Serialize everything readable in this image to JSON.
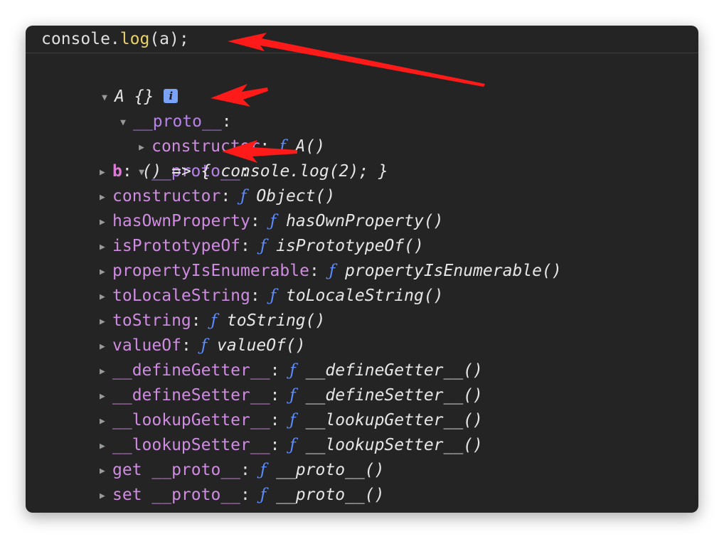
{
  "command": {
    "prefix": "console.",
    "func": "log",
    "suffix": "(a);"
  },
  "root": {
    "label": "A {}",
    "info_badge": "i"
  },
  "tree": {
    "proto1": {
      "key": "__proto__",
      "colon": ":"
    },
    "constructor_a": {
      "key": "constructor",
      "colon": ":",
      "f": "ƒ",
      "val": "A()"
    },
    "proto2": {
      "key": "__proto__",
      "colon": ":"
    },
    "items": [
      {
        "key": "b",
        "colon": ":",
        "f": "",
        "val": "() => { console.log(2); }",
        "own": true
      },
      {
        "key": "constructor",
        "colon": ":",
        "f": "ƒ",
        "val": "Object()"
      },
      {
        "key": "hasOwnProperty",
        "colon": ":",
        "f": "ƒ",
        "val": "hasOwnProperty()"
      },
      {
        "key": "isPrototypeOf",
        "colon": ":",
        "f": "ƒ",
        "val": "isPrototypeOf()"
      },
      {
        "key": "propertyIsEnumerable",
        "colon": ":",
        "f": "ƒ",
        "val": "propertyIsEnumerable()"
      },
      {
        "key": "toLocaleString",
        "colon": ":",
        "f": "ƒ",
        "val": "toLocaleString()"
      },
      {
        "key": "toString",
        "colon": ":",
        "f": "ƒ",
        "val": "toString()"
      },
      {
        "key": "valueOf",
        "colon": ":",
        "f": "ƒ",
        "val": "valueOf()"
      },
      {
        "key": "__defineGetter__",
        "colon": ":",
        "f": "ƒ",
        "val": "__defineGetter__()"
      },
      {
        "key": "__defineSetter__",
        "colon": ":",
        "f": "ƒ",
        "val": "__defineSetter__()"
      },
      {
        "key": "__lookupGetter__",
        "colon": ":",
        "f": "ƒ",
        "val": "__lookupGetter__()"
      },
      {
        "key": "__lookupSetter__",
        "colon": ":",
        "f": "ƒ",
        "val": "__lookupSetter__()"
      },
      {
        "key": "get __proto__",
        "colon": ":",
        "f": "ƒ",
        "val": "__proto__()"
      },
      {
        "key": "set __proto__",
        "colon": ":",
        "f": "ƒ",
        "val": "__proto__()"
      }
    ]
  },
  "icons": {
    "expanded": "▼",
    "collapsed": "▶"
  },
  "colors": {
    "background": "#242424",
    "annotation_arrow": "#ff1a1a"
  }
}
